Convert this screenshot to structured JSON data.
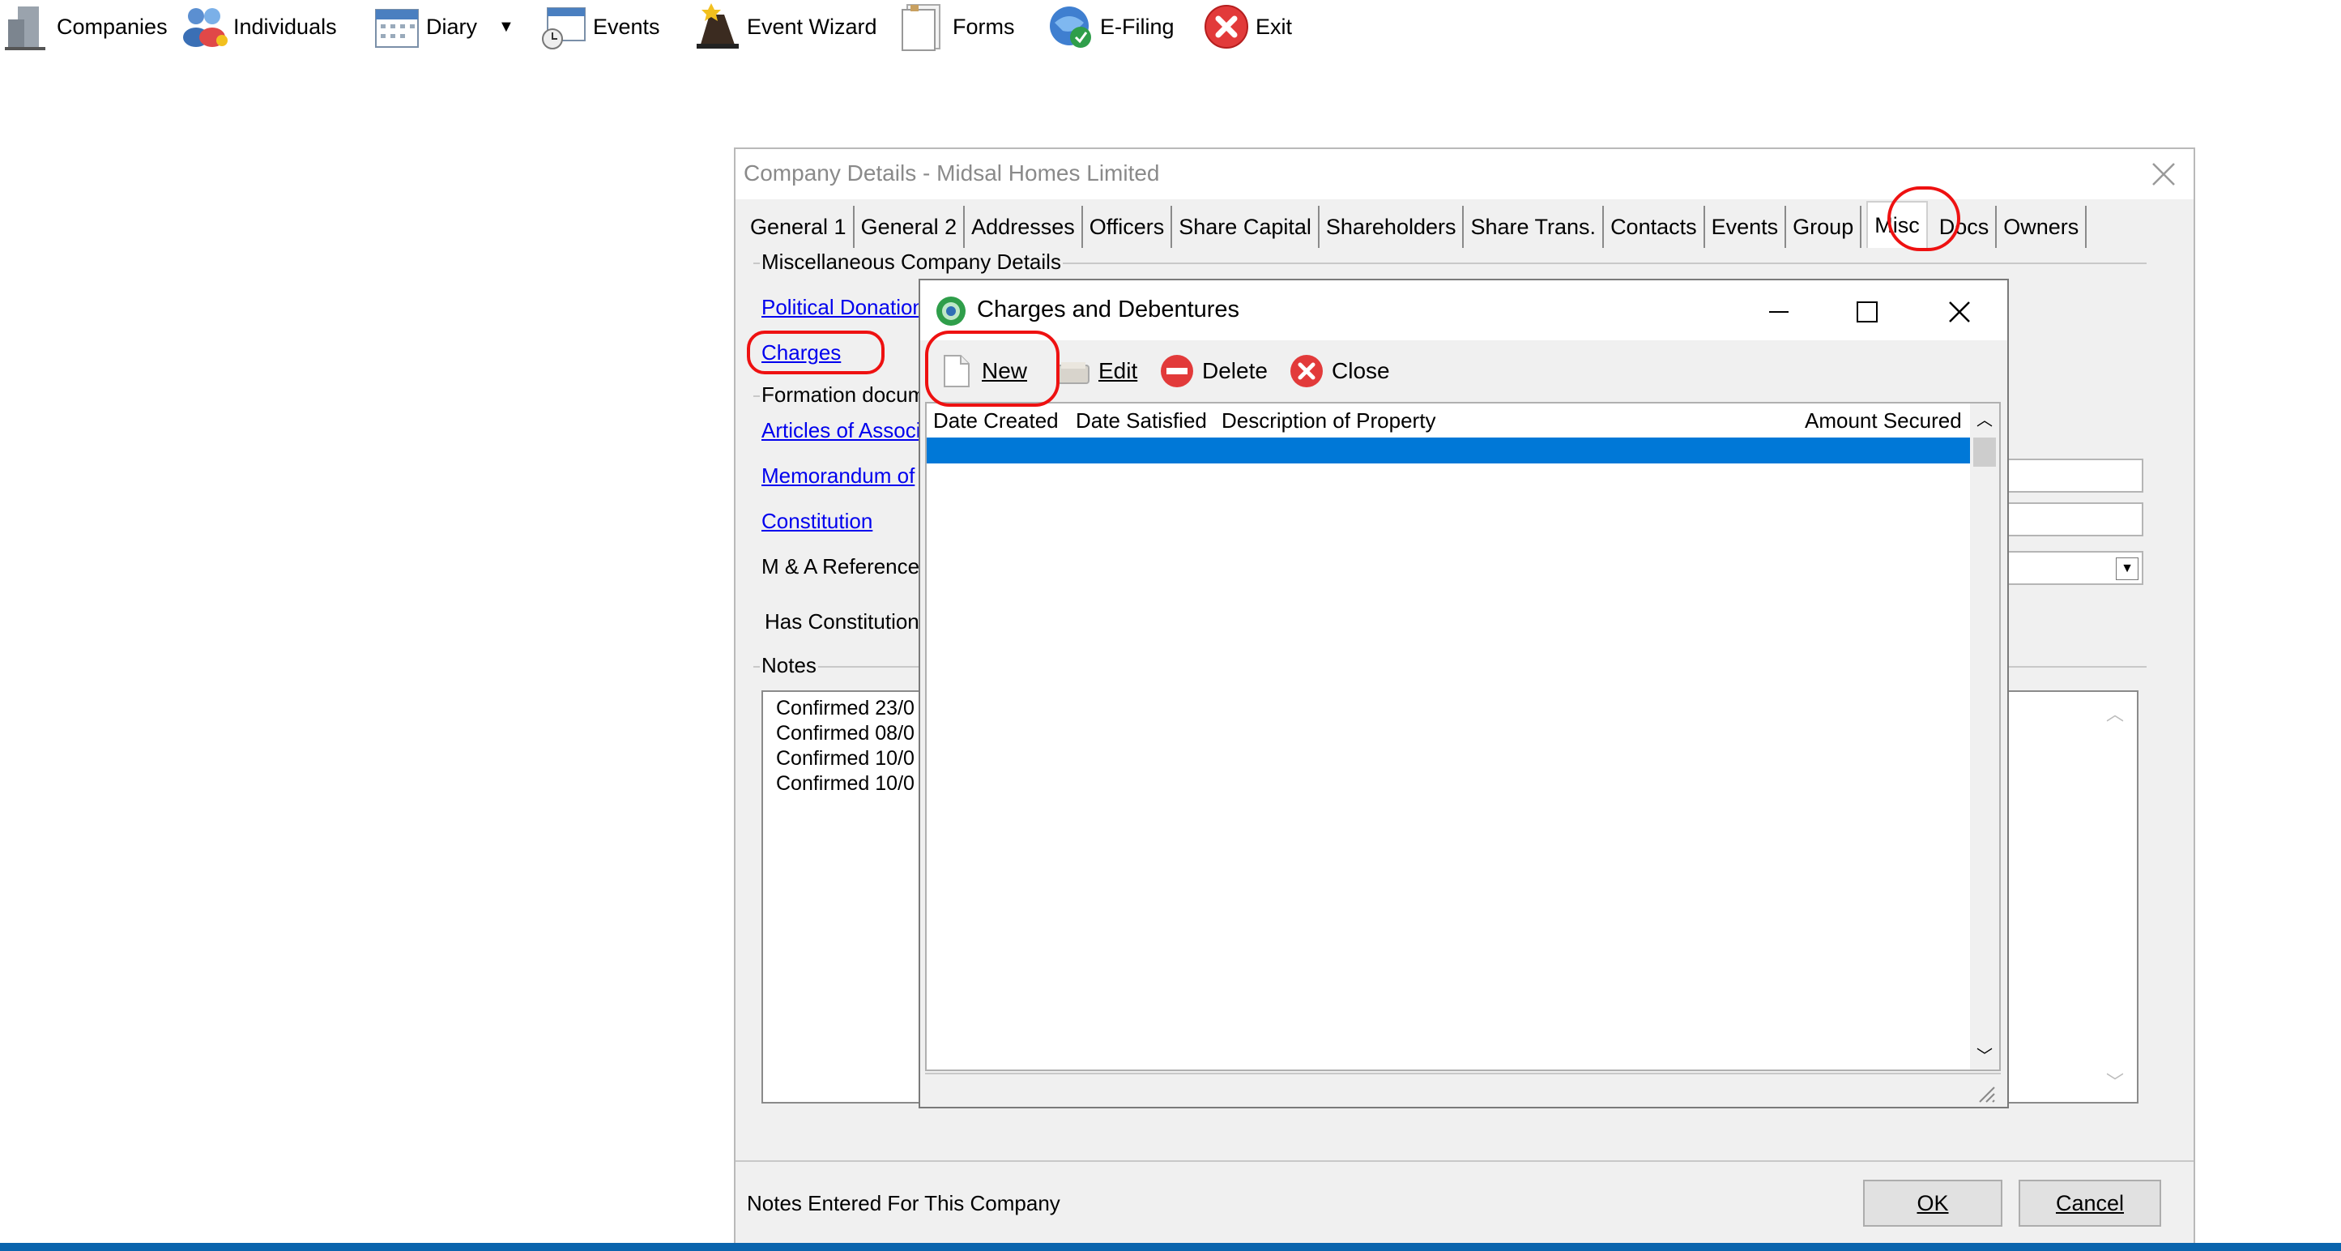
{
  "toolbar": {
    "items": [
      {
        "label": "Companies",
        "icon": "companies-icon"
      },
      {
        "label": "Individuals",
        "icon": "individuals-icon"
      },
      {
        "label": "Diary",
        "icon": "diary-icon"
      },
      {
        "label": "Events",
        "icon": "events-icon"
      },
      {
        "label": "Event Wizard",
        "icon": "event-wizard-icon"
      },
      {
        "label": "Forms",
        "icon": "forms-icon"
      },
      {
        "label": "E-Filing",
        "icon": "efiling-icon"
      },
      {
        "label": "Exit",
        "icon": "exit-icon"
      }
    ]
  },
  "company_window": {
    "title": "Company Details - Midsal Homes Limited",
    "tabs": [
      "General 1",
      "General 2",
      "Addresses",
      "Officers",
      "Share Capital",
      "Shareholders",
      "Share Trans.",
      "Contacts",
      "Events",
      "Group",
      "Misc",
      "Docs",
      "Owners"
    ],
    "active_tab": "Misc",
    "misc_group_label": "Miscellaneous Company Details",
    "political_donations_link": "Political Donation",
    "charges_link": "Charges",
    "formation_group_label": "Formation docum",
    "articles_link": "Articles of Associ",
    "memorandum_link": "Memorandum of",
    "constitution_link": "Constitution",
    "ma_reference_label": "M & A Reference",
    "has_constitution_label": "Has Constitution",
    "notes_group_label": "Notes",
    "notes_lines": [
      "Confirmed  23/0",
      "Confirmed  08/0",
      "Confirmed  10/0",
      "Confirmed  10/0"
    ],
    "status_text": "Notes Entered For This Company",
    "ok_label": "OK",
    "cancel_label": "Cancel"
  },
  "charges_dialog": {
    "title": "Charges and Debentures",
    "toolbar": {
      "new": "New",
      "edit": "Edit",
      "delete": "Delete",
      "close": "Close"
    },
    "columns": [
      "Date Created",
      "Date Satisfied",
      "Description of Property",
      "Amount Secured"
    ]
  },
  "colors": {
    "selection": "#0078d7",
    "link": "#0000ee",
    "annotation": "#ee1111",
    "taskbar": "#0a64ad"
  }
}
